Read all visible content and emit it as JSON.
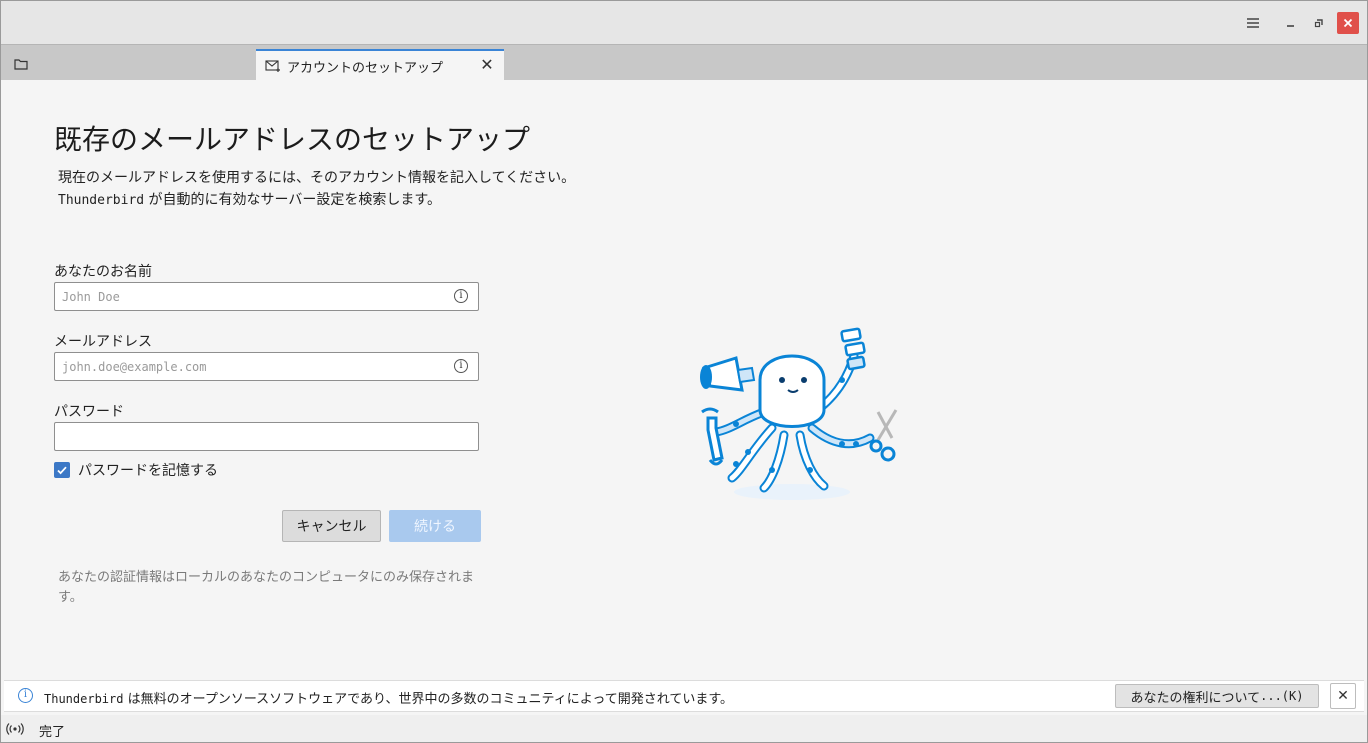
{
  "window": {
    "controls": [
      "menu-icon",
      "minimize-icon",
      "maximize-icon",
      "close-icon"
    ]
  },
  "tabs": [
    {
      "icon": "folder-icon",
      "label": ""
    },
    {
      "icon": "mail-setup-icon",
      "label": "アカウントのセットアップ",
      "active": true
    }
  ],
  "accent_color": "#3a84d6",
  "main": {
    "title": "既存のメールアドレスのセットアップ",
    "intro_line1": "現在のメールアドレスを使用するには、そのアカウント情報を記入してください。",
    "intro_app": "Thunderbird",
    "intro_line2": " が自動的に有効なサーバー設定を検索します。",
    "name_label": "あなたのお名前",
    "name_placeholder": "John Doe",
    "name_value": "",
    "email_label": "メールアドレス",
    "email_placeholder": "john.doe@example.com",
    "email_value": "",
    "password_label": "パスワード",
    "password_value": "",
    "remember_label": "パスワードを記憶する",
    "remember_checked": true,
    "cancel_label": "キャンセル",
    "continue_label": "続ける",
    "privacy_note": "あなたの認証情報はローカルのあなたのコンピュータにのみ保存されます。"
  },
  "notification": {
    "icon": "info-icon",
    "app": "Thunderbird",
    "text": " は無料のオープンソースソフトウェアであり、世界中の多数のコミュニティによって開発されています。",
    "button_label": "あなたの権利について",
    "button_suffix": "...(K)"
  },
  "statusbar": {
    "icon": "connection-icon",
    "text": "完了"
  }
}
